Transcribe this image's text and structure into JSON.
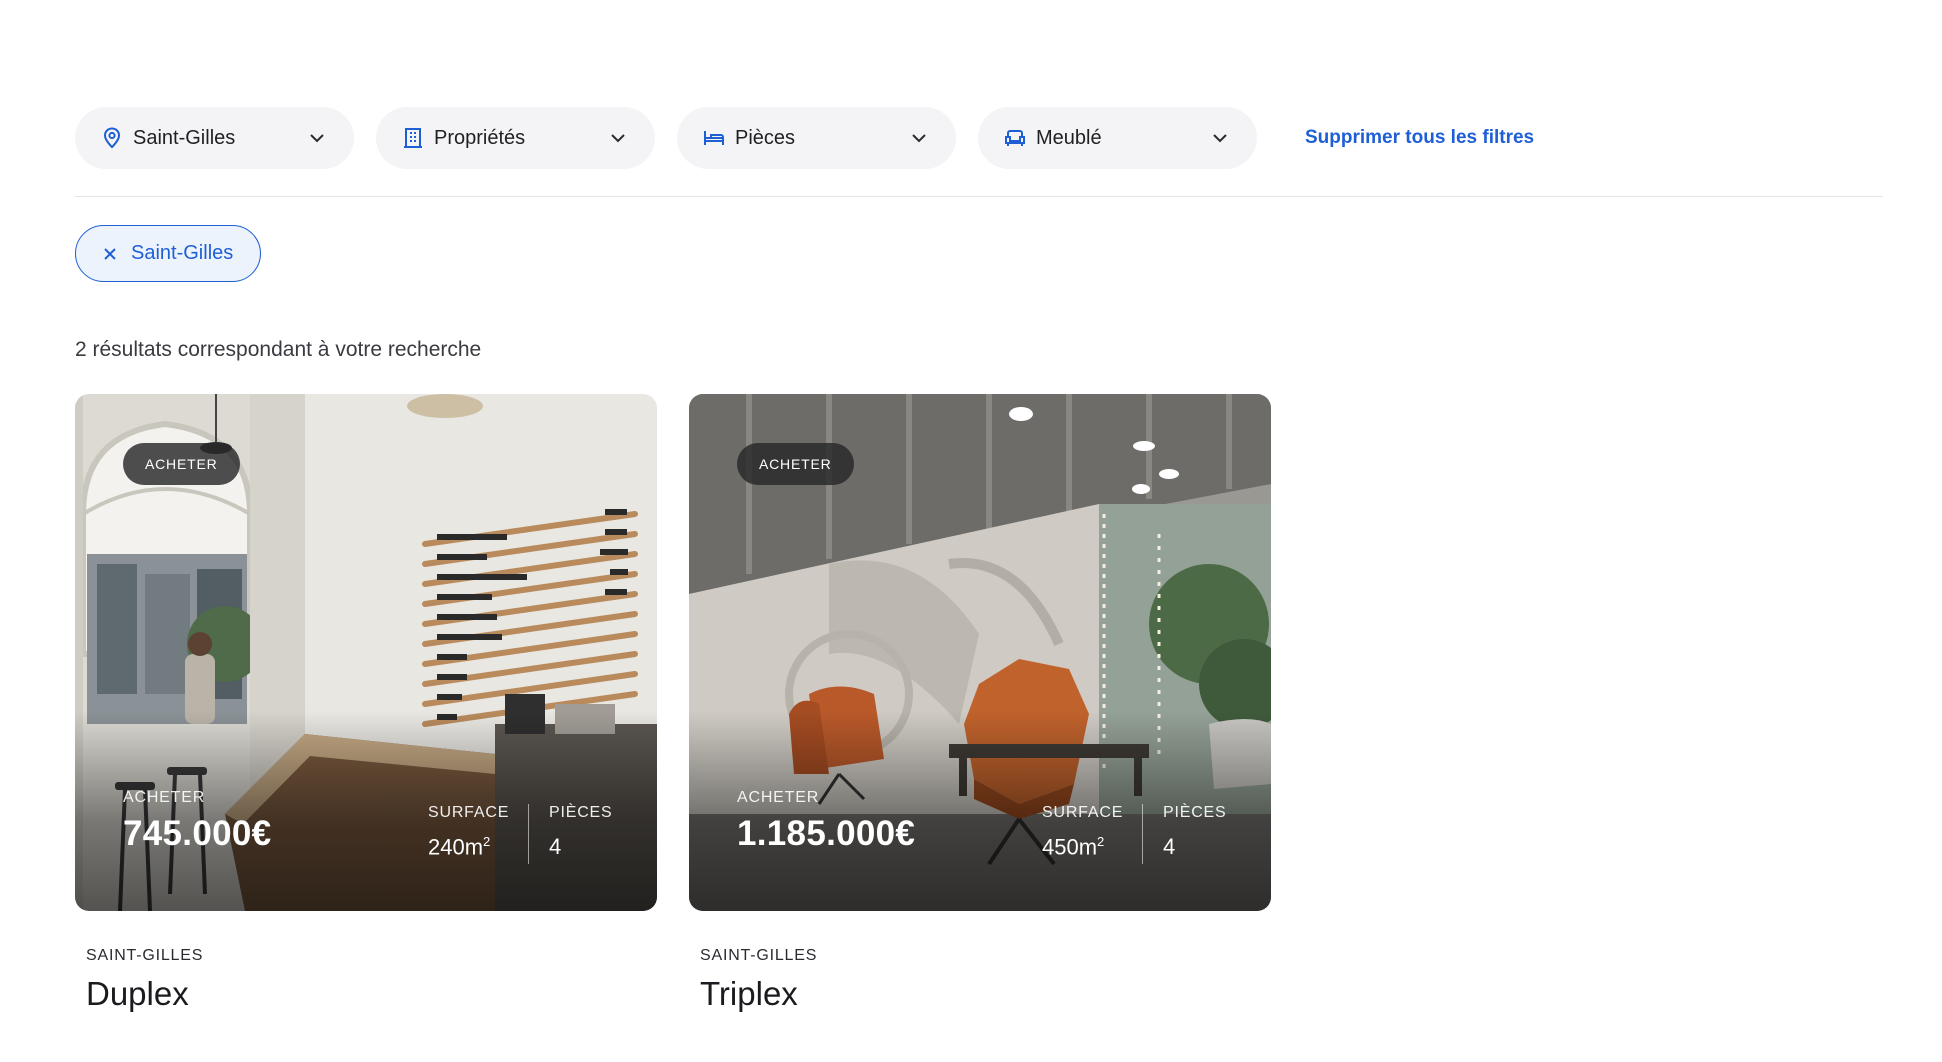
{
  "filters": [
    {
      "label": "Saint-Gilles",
      "icon": "location-pin-icon"
    },
    {
      "label": "Propriétés",
      "icon": "building-icon"
    },
    {
      "label": "Pièces",
      "icon": "bed-icon"
    },
    {
      "label": "Meublé",
      "icon": "sofa-icon"
    }
  ],
  "clear_all_label": "Supprimer tous les filtres",
  "active_chip": {
    "label": "Saint-Gilles"
  },
  "result_count": "2 résultats correspondant à votre recherche",
  "listings": [
    {
      "badge": "ACHETER",
      "type": "ACHETER",
      "price": "745.000€",
      "surface_label": "SURFACE",
      "surface_value": "240m",
      "surface_unit_exp": "2",
      "rooms_label": "PIÈCES",
      "rooms_value": "4",
      "location": "SAINT-GILLES",
      "title": "Duplex"
    },
    {
      "badge": "ACHETER",
      "type": "ACHETER",
      "price": "1.185.000€",
      "surface_label": "SURFACE",
      "surface_value": "450m",
      "surface_unit_exp": "2",
      "rooms_label": "PIÈCES",
      "rooms_value": "4",
      "location": "SAINT-GILLES",
      "title": "Triplex"
    }
  ],
  "colors": {
    "accent": "#1f5fd6",
    "chip_bg": "#edf3fd",
    "filter_bg": "#f4f4f6"
  }
}
